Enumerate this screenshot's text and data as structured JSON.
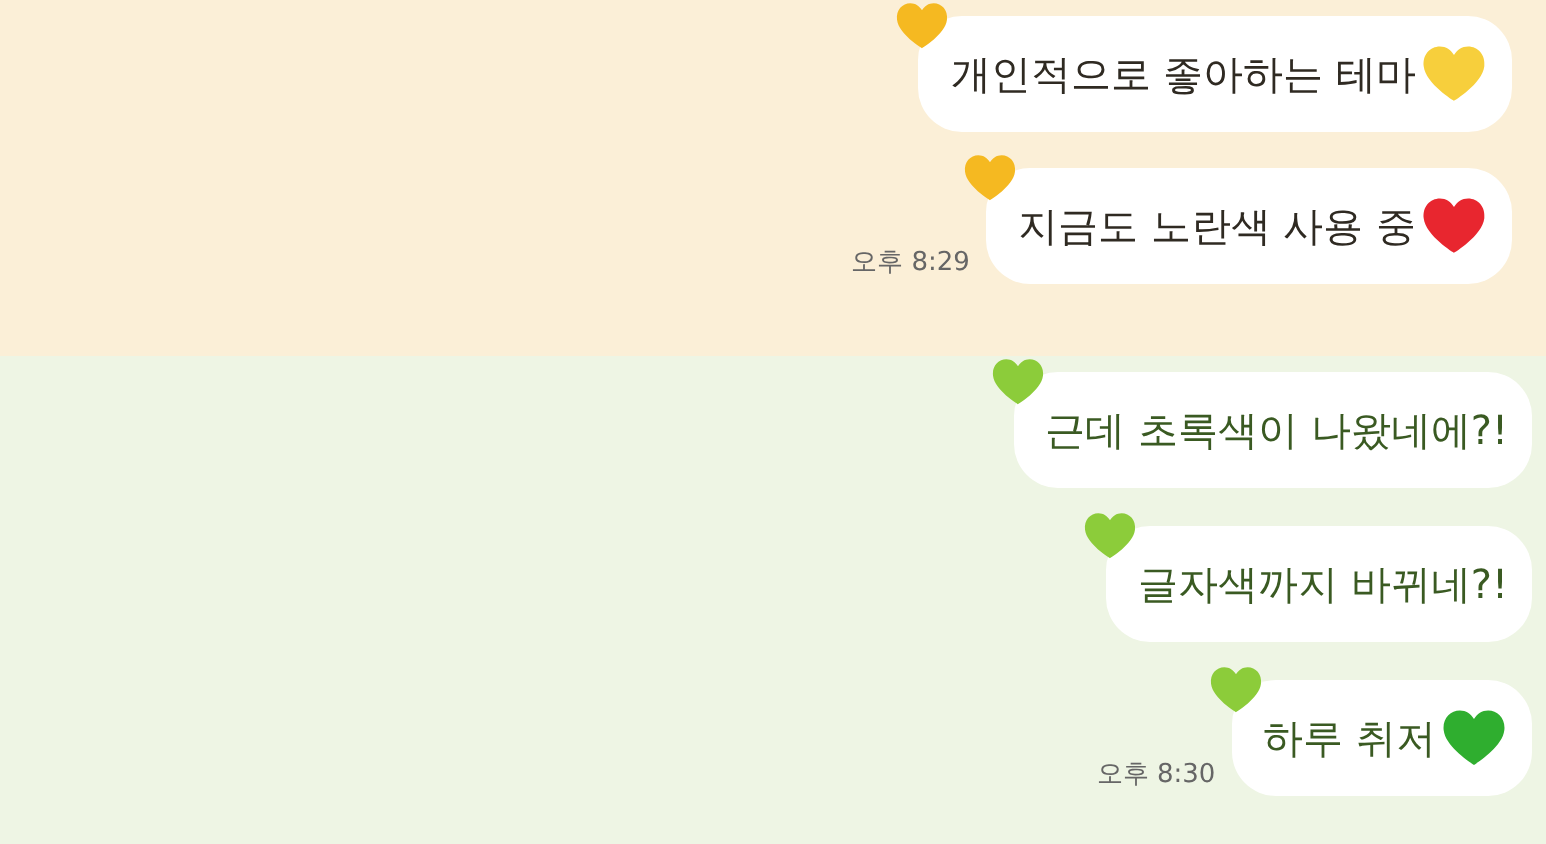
{
  "sections": [
    {
      "kind": "yellow",
      "messages": [
        {
          "text": "개인적으로 좋아하는 테마",
          "emoji": {
            "color": "#f7cf3c"
          }
        },
        {
          "text": "지금도 노란색 사용 중",
          "emoji": {
            "color": "#e8262f"
          }
        }
      ],
      "time": "오후 8:29"
    },
    {
      "kind": "green",
      "messages": [
        {
          "text": "근데 초록색이 나왔네에?!"
        },
        {
          "text": "글자색까지 바뀌네?!"
        },
        {
          "text": "하루 취저",
          "emoji": {
            "color": "#2fae2f"
          }
        }
      ],
      "time": "오후 8:30"
    }
  ]
}
